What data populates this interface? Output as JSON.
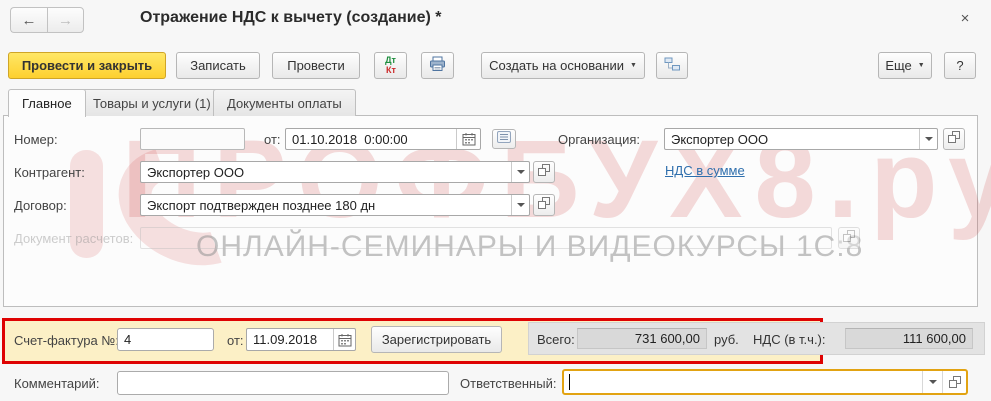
{
  "window": {
    "title": "Отражение НДС к вычету (создание) *"
  },
  "icons": {
    "back": "←",
    "forward": "→",
    "close": "×",
    "caret": "▼"
  },
  "toolbar": {
    "post_and_close": "Провести и закрыть",
    "save": "Записать",
    "post": "Провести",
    "dt": "Дт",
    "kt": "Кт",
    "create_based_on": "Создать на основании",
    "more": "Еще",
    "help": "?"
  },
  "tabs": [
    {
      "label": "Главное",
      "active": true
    },
    {
      "label": "Товары и услуги (1)",
      "active": false
    },
    {
      "label": "Документы оплаты",
      "active": false
    }
  ],
  "form": {
    "number_label": "Номер:",
    "number_value": "",
    "date_label": "от:",
    "date_value": "01.10.2018  0:00:00",
    "organization_label": "Организация:",
    "organization_value": "Экспортер ООО",
    "vat_link": "НДС в сумме",
    "counterparty_label": "Контрагент:",
    "counterparty_value": "Экспортер ООО",
    "contract_label": "Договор:",
    "contract_value": "Экспорт подтвержден позднее 180 дн",
    "settlement_doc_label": "Документ расчетов:",
    "settlement_doc_value": ""
  },
  "watermark": {
    "main": "ПРОФБУХ8.ру",
    "sub": "ОНЛАЙН-СЕМИНАРЫ И ВИДЕОКУРСЫ 1С:8"
  },
  "invoice": {
    "label": "Счет-фактура №:",
    "number": "4",
    "date_label": "от:",
    "date": "11.09.2018",
    "register": "Зарегистрировать"
  },
  "totals": {
    "total_label": "Всего:",
    "total_value": "731 600,00",
    "currency": "руб.",
    "vat_label": "НДС (в т.ч.):",
    "vat_value": "111 600,00"
  },
  "footer": {
    "comment_label": "Комментарий:",
    "comment_value": "",
    "responsible_label": "Ответственный:",
    "responsible_value": ""
  },
  "colors": {
    "accent_yellow": "#fdd02f",
    "highlight_red": "#de0202",
    "link_blue": "#2f6fad",
    "focus_orange": "#e2a312",
    "watermark_pink": "rgba(206,62,62,0.18)"
  }
}
